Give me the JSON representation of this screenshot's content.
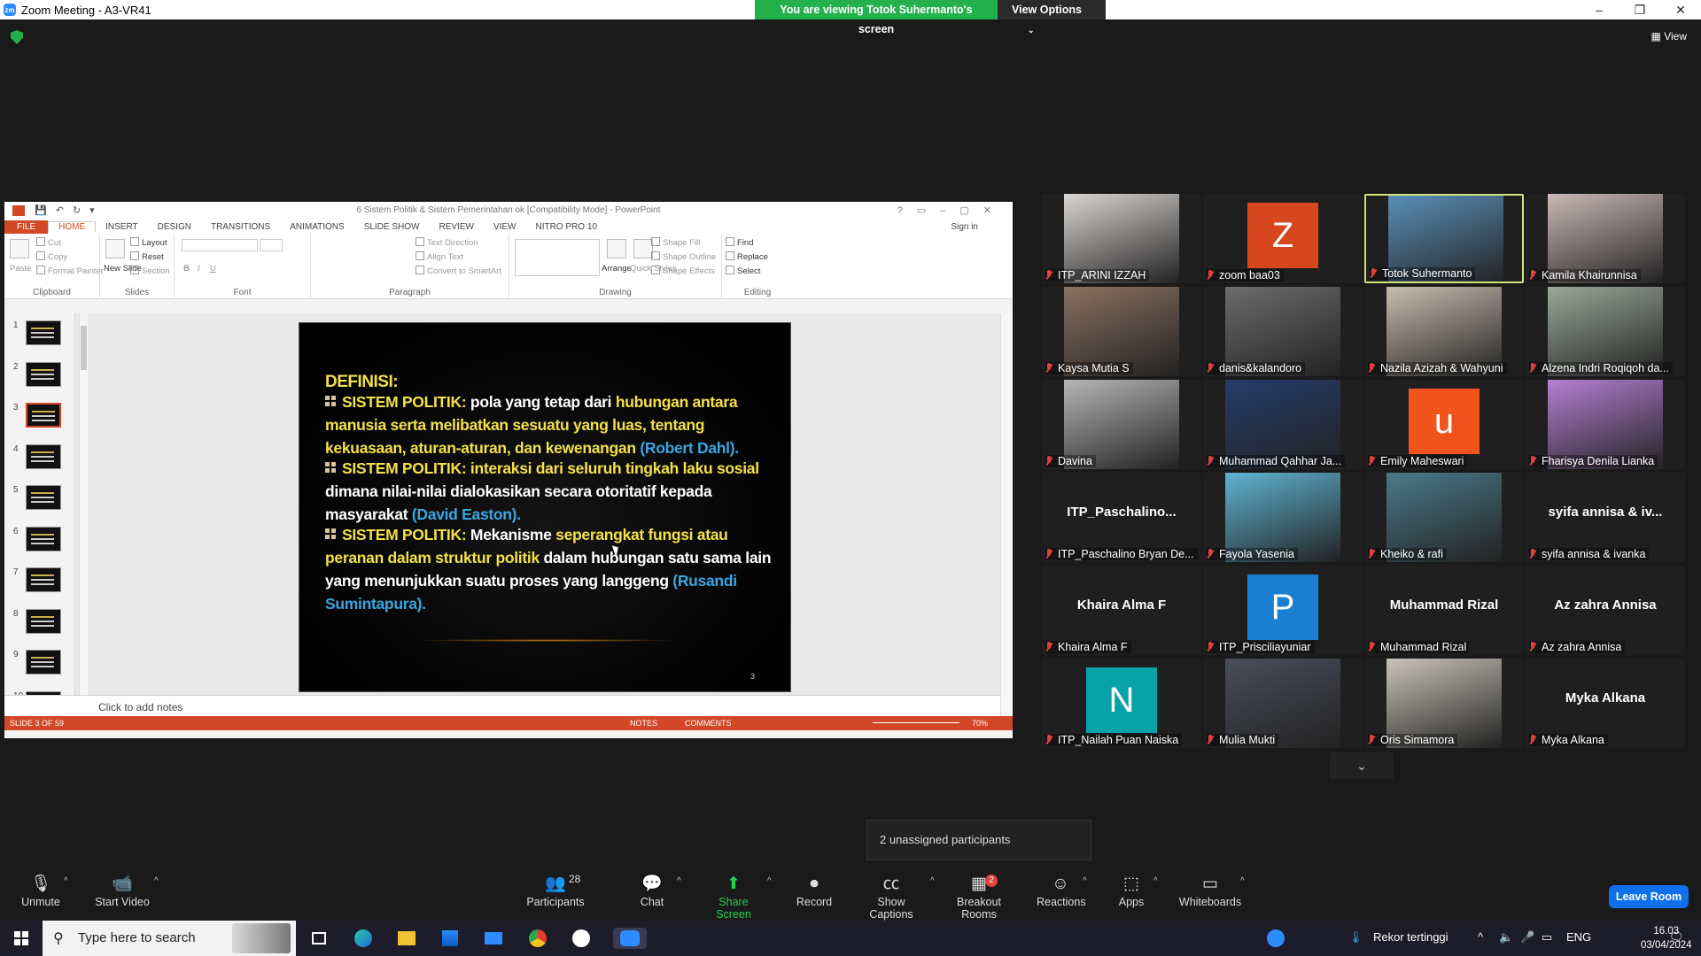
{
  "window": {
    "title": "Zoom Meeting - A3-VR41",
    "controls": [
      "–",
      "❐",
      "✕"
    ]
  },
  "banner": {
    "viewing_text": "You are viewing Totok Suhermanto's screen",
    "view_options": "View Options"
  },
  "top_right": {
    "view_label": "View"
  },
  "ppt": {
    "doc_title": "6 Sistem Politik & Sistem Pemerintahan ok [Compatibility Mode] - PowerPoint",
    "tabs": [
      "FILE",
      "HOME",
      "INSERT",
      "DESIGN",
      "TRANSITIONS",
      "ANIMATIONS",
      "SLIDE SHOW",
      "REVIEW",
      "VIEW",
      "NITRO PRO 10"
    ],
    "sign_in": "Sign in",
    "ribbon": {
      "clipboard": {
        "label": "Clipboard",
        "paste": "Paste",
        "cut": "Cut",
        "copy": "Copy",
        "format_painter": "Format Painter"
      },
      "slides": {
        "label": "Slides",
        "new_slide": "New Slide",
        "layout": "Layout",
        "reset": "Reset",
        "section": "Section"
      },
      "font": {
        "label": "Font"
      },
      "paragraph": {
        "label": "Paragraph",
        "text_direction": "Text Direction",
        "align_text": "Align Text",
        "convert": "Convert to SmartArt"
      },
      "drawing": {
        "label": "Drawing",
        "arrange": "Arrange",
        "quick_styles": "Quick Styles",
        "shape_fill": "Shape Fill",
        "shape_outline": "Shape Outline",
        "shape_effects": "Shape Effects"
      },
      "editing": {
        "label": "Editing",
        "find": "Find",
        "replace": "Replace",
        "select": "Select"
      }
    },
    "thumbnails": [
      "1",
      "2",
      "3",
      "4",
      "5",
      "6",
      "7",
      "8",
      "9",
      "10"
    ],
    "active_thumbnail": 3,
    "slide": {
      "title": "DEFINISI:",
      "p1": {
        "a": "SISTEM POLITIK:",
        "b": " pola yang tetap dari ",
        "c": "hubungan antara manusia serta melibatkan sesuatu yang luas,",
        "d": " tentang kekuasaan, aturan-aturan, dan kewenangan",
        "e": " (Robert Dahl)."
      },
      "p2": {
        "a": "SISTEM POLITIK:",
        "b": " interaksi dari seluruh tingkah laku sosial",
        "c": " dimana nilai-nilai dialokasikan secara otoritatif kepada masyarakat",
        "d": " (David Easton)."
      },
      "p3": {
        "a": "SISTEM POLITIK:",
        "b": " Mekanisme ",
        "c": "seperangkat fungsi atau peranan dalam struktur politik",
        "d": " dalam hubungan satu sama lain yang menunjukkan suatu proses yang langgeng",
        "e": " (Rusandi Sumintapura)."
      },
      "number": "3"
    },
    "notes_placeholder": "Click to add notes",
    "status": {
      "slide": "SLIDE 3 OF 59",
      "notes": "NOTES",
      "comments": "COMMENTS",
      "zoom": "70%"
    }
  },
  "participants": [
    {
      "name": "ITP_ARINI IZZAH",
      "kind": "video",
      "color": "#d9d5d2"
    },
    {
      "name": "zoom baa03",
      "kind": "avatar",
      "letter": "Z",
      "color": "#d6461f"
    },
    {
      "name": "Totok Suhermanto",
      "kind": "video",
      "color": "#5a8fb8",
      "active": true
    },
    {
      "name": "Kamila Khairunnisa",
      "kind": "video",
      "color": "#c9b8b6"
    },
    {
      "name": "Kaysa Mutia S",
      "kind": "video",
      "color": "#8a7160"
    },
    {
      "name": "danis&kalandoro",
      "kind": "video",
      "color": "#6c6c6c"
    },
    {
      "name": "Nazila  Azizah & Wahyuni",
      "kind": "video",
      "color": "#c8bcae"
    },
    {
      "name": "Alzena Indri Roqiqoh da...",
      "kind": "video",
      "color": "#9aa79a"
    },
    {
      "name": "Davina",
      "kind": "video",
      "color": "#b6b6b6"
    },
    {
      "name": "Muhammad Qahhar Ja...",
      "kind": "video",
      "color": "#243d6b"
    },
    {
      "name": "Emily Maheswari",
      "kind": "avatar",
      "letter": "u",
      "color": "#f0531c"
    },
    {
      "name": "Fharisya Denila Lianka",
      "kind": "video",
      "color": "#b67fd4"
    },
    {
      "name": "ITP_Paschalino Bryan De...",
      "kind": "name",
      "bigname": "ITP_Paschalino..."
    },
    {
      "name": "Fayola Yasenia",
      "kind": "video",
      "color": "#5fb4d3"
    },
    {
      "name": "Kheiko & rafi",
      "kind": "video",
      "color": "#4a7a8a"
    },
    {
      "name": "syifa annisa & ivanka",
      "kind": "name",
      "bigname": "syifa annisa & iv..."
    },
    {
      "name": "Khaira Alma F",
      "kind": "name",
      "bigname": "Khaira Alma F"
    },
    {
      "name": "ITP_Prisciliayuniar",
      "kind": "avatar",
      "letter": "P",
      "color": "#1a7fd0"
    },
    {
      "name": "Muhammad Rizal",
      "kind": "name",
      "bigname": "Muhammad Rizal"
    },
    {
      "name": "Az zahra Annisa",
      "kind": "name",
      "bigname": "Az zahra Annisa"
    },
    {
      "name": "ITP_Nailah Puan Naiska",
      "kind": "avatar",
      "letter": "N",
      "color": "#07a3a8"
    },
    {
      "name": "Mulia Mukti",
      "kind": "video",
      "color": "#4a4e5a"
    },
    {
      "name": "Oris Simamora",
      "kind": "video",
      "color": "#c9c4b8"
    },
    {
      "name": "Myka Alkana",
      "kind": "name",
      "bigname": "Myka Alkana"
    }
  ],
  "gallery_more": "⌄",
  "unassigned": "2 unassigned participants",
  "toolbar": {
    "unmute": "Unmute",
    "start_video": "Start Video",
    "participants": "Participants",
    "participants_count": "28",
    "chat": "Chat",
    "share_screen": "Share Screen",
    "record": "Record",
    "show_captions": "Show Captions",
    "breakout_rooms": "Breakout Rooms",
    "breakout_badge": "2",
    "reactions": "Reactions",
    "apps": "Apps",
    "whiteboards": "Whiteboards",
    "leave": "Leave Room"
  },
  "taskbar": {
    "search_placeholder": "Type here to search",
    "weather": "Rekor tertinggi",
    "lang": "ENG",
    "time": "16.03",
    "date": "03/04/2024"
  }
}
